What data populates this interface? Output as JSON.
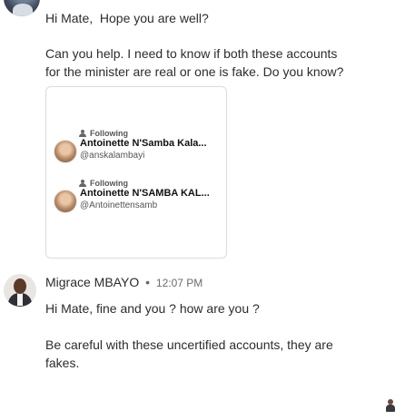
{
  "message1": {
    "line1": "Hi Mate,  Hope you are well?",
    "line2": "Can you help. I need to know if both these accounts\nfor the minister are real or one is fake. Do you know?"
  },
  "card": {
    "accounts": [
      {
        "status": "Following",
        "name": "Antoinette N'Samba Kala...",
        "handle": "@anskalambayi"
      },
      {
        "status": "Following",
        "name": "Antoinette N'SAMBA KAL...",
        "handle": "@Antoinettensamb"
      }
    ]
  },
  "message2": {
    "sender": "Migrace MBAYO",
    "separator": "•",
    "time": "12:07 PM",
    "line1": "Hi Mate, fine and you ? how are you ?",
    "line2": "Be careful with these uncertified accounts, they are\nfakes."
  }
}
